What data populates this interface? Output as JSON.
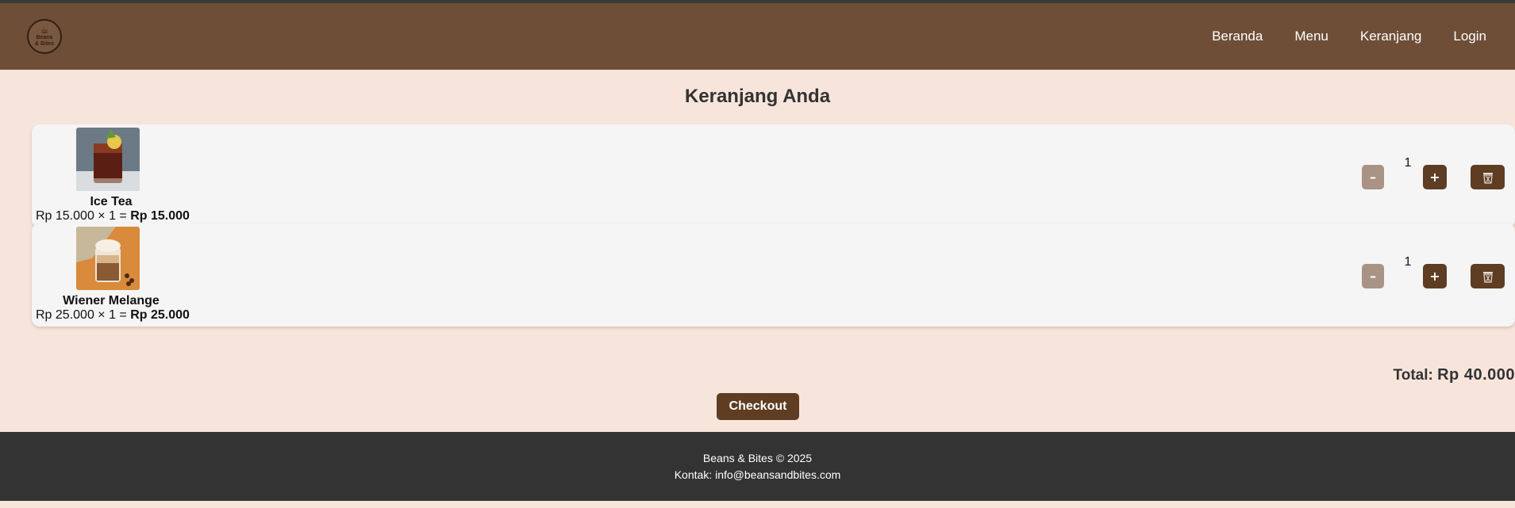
{
  "header": {
    "logo_top": "Beans",
    "logo_bottom": "& Bites",
    "nav": [
      "Beranda",
      "Menu",
      "Keranjang",
      "Login"
    ]
  },
  "cart": {
    "title": "Keranjang Anda",
    "items": [
      {
        "name": "Ice Tea",
        "unit_price": "Rp 15.000",
        "multiplier": "× 1 =",
        "subtotal": "Rp 15.000",
        "quantity": "1",
        "minus_label": "–",
        "plus_label": "+"
      },
      {
        "name": "Wiener Melange",
        "unit_price": "Rp 25.000",
        "multiplier": "× 1 =",
        "subtotal": "Rp 25.000",
        "quantity": "1",
        "minus_label": "–",
        "plus_label": "+"
      }
    ],
    "total_label": "Total:",
    "total_value": "Rp 40.000",
    "checkout_label": "Checkout"
  },
  "footer": {
    "copyright": "Beans & Bites © 2025",
    "contact": "Kontak: info@beansandbites.com"
  },
  "colors": {
    "header_bg": "#6e4e37",
    "page_bg": "#f7e5dc",
    "accent_button": "#5e3d23",
    "minus_button": "#a89384",
    "footer_bg": "#333333"
  }
}
